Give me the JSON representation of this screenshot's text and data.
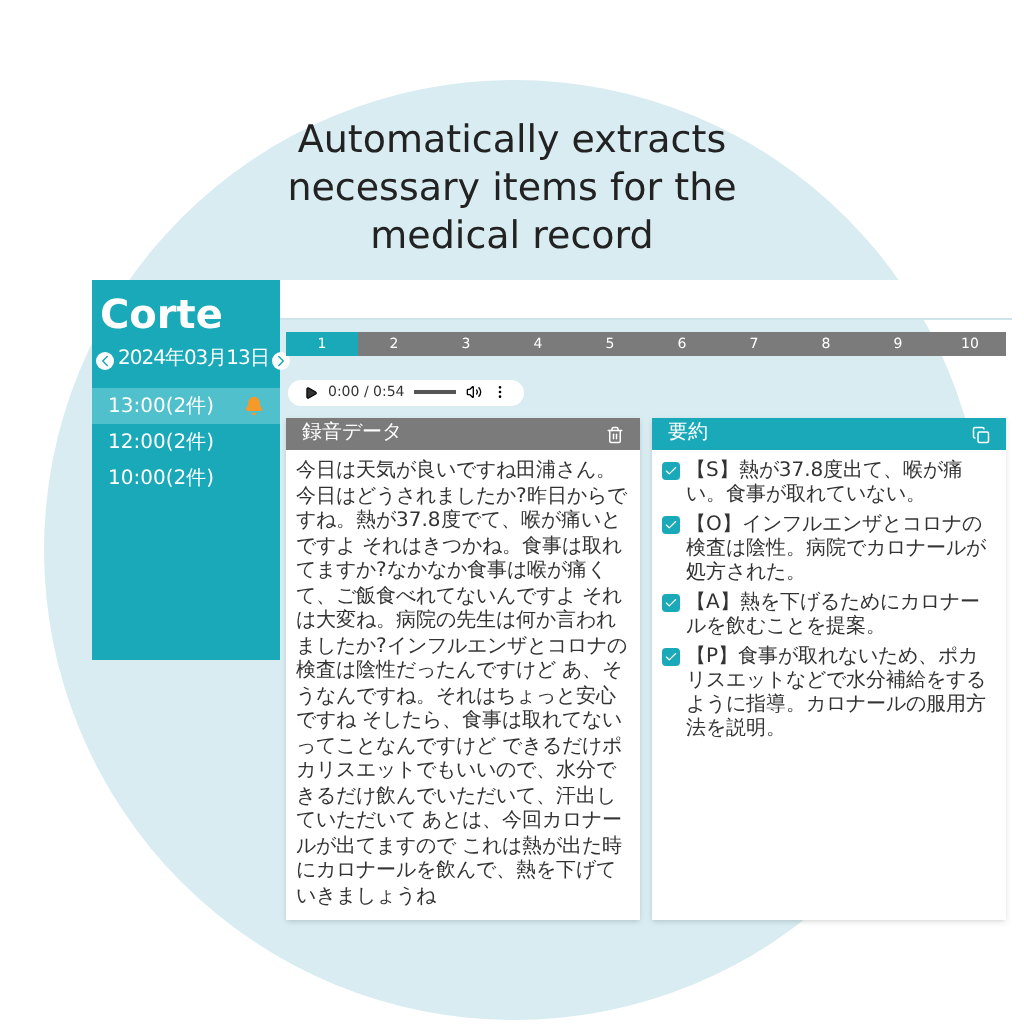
{
  "headline": [
    "Automatically extracts",
    "necessary items for the",
    "medical record"
  ],
  "logo": "Corte",
  "sidebar": {
    "date": "2024年03月13日",
    "items": [
      {
        "label": "13:00(2件)",
        "selected": true,
        "alert": true
      },
      {
        "label": "12:00(2件)",
        "selected": false,
        "alert": false
      },
      {
        "label": "10:00(2件)",
        "selected": false,
        "alert": false
      }
    ]
  },
  "tabs": [
    {
      "label": "1",
      "selected": true
    },
    {
      "label": "2",
      "selected": false
    },
    {
      "label": "3",
      "selected": false
    },
    {
      "label": "4",
      "selected": false
    },
    {
      "label": "5",
      "selected": false
    },
    {
      "label": "6",
      "selected": false
    },
    {
      "label": "7",
      "selected": false
    },
    {
      "label": "8",
      "selected": false
    },
    {
      "label": "9",
      "selected": false
    },
    {
      "label": "10",
      "selected": false
    }
  ],
  "audio": {
    "time": "0:00 / 0:54"
  },
  "transcript": {
    "title": "録音データ",
    "text": "今日は天気が良いですね田浦さん。今日はどうされましたか?昨日からですね。熱が37.8度でて、喉が痛いとですよ それはきつかね。食事は取れてますか?なかなか食事は喉が痛くて、ご飯食べれてないんですよ それは大変ね。病院の先生は何か言われましたか?インフルエンザとコロナの検査は陰性だったんですけど あ、そうなんですね。それはちょっと安心ですね そしたら、食事は取れてないってことなんですけど できるだけポカリスエットでもいいので、水分できるだけ飲んでいただいて、汗出していただいて あとは、今回カロナールが出てますので これは熱が出た時にカロナールを飲んで、熱を下げていきましょうね"
  },
  "summary": {
    "title": "要約",
    "items": [
      {
        "text": "【S】熱が37.8度出て、喉が痛い。食事が取れていない。",
        "checked": true
      },
      {
        "text": "【O】インフルエンザとコロナの検査は陰性。病院でカロナールが処方された。",
        "checked": true
      },
      {
        "text": "【A】熱を下げるためにカロナールを飲むことを提案。",
        "checked": true
      },
      {
        "text": "【P】食事が取れないため、ポカリスエットなどで水分補給をするように指導。カロナールの服用方法を説明。",
        "checked": true
      }
    ]
  }
}
